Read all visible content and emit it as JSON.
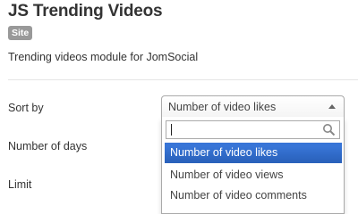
{
  "module": {
    "title": "JS Trending Videos",
    "badge": "Site",
    "description": "Trending videos module for JomSocial"
  },
  "fields": {
    "sort_by_label": "Sort by",
    "days_label": "Number of days",
    "limit_label": "Limit"
  },
  "sort_select": {
    "selected": "Number of video likes",
    "search_value": "",
    "options": [
      {
        "label": "Number of video likes",
        "highlighted": true
      },
      {
        "label": "Number of video views",
        "highlighted": false
      },
      {
        "label": "Number of video comments",
        "highlighted": false
      }
    ]
  },
  "colors": {
    "highlight": "#3875d7",
    "badge": "#999999"
  },
  "icons": {
    "select_arrow": "arrow-up-icon",
    "search": "search-icon"
  }
}
